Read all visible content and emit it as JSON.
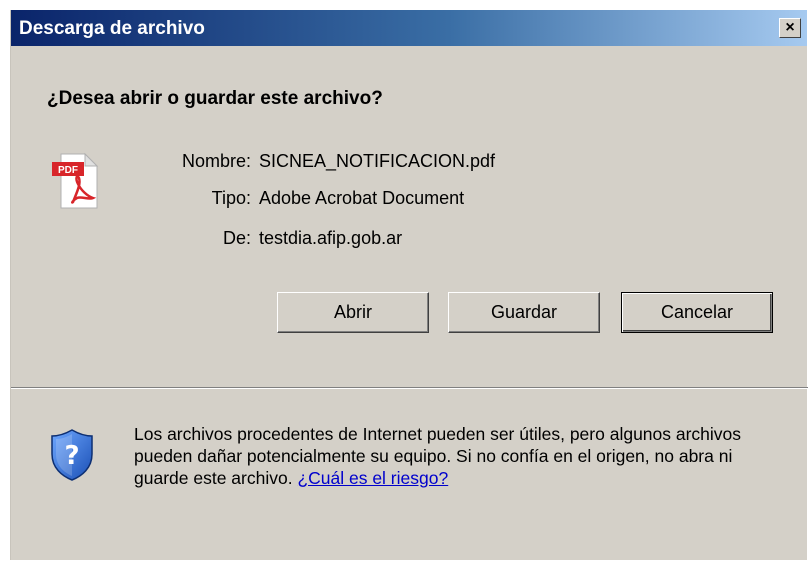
{
  "window": {
    "title": "Descarga de archivo",
    "close_glyph": "×"
  },
  "question": "¿Desea abrir o guardar este archivo?",
  "file": {
    "icon": "pdf-file-icon",
    "icon_badge": "PDF",
    "name_label": "Nombre:",
    "name_value": "SICNEA_NOTIFICACION.pdf",
    "type_label": "Tipo:",
    "type_value": "Adobe Acrobat Document",
    "from_label": "De:",
    "from_value": "testdia.afip.gob.ar"
  },
  "buttons": {
    "open": "Abrir",
    "save": "Guardar",
    "cancel": "Cancelar"
  },
  "warning": {
    "icon": "shield-question-icon",
    "text": "Los archivos procedentes de Internet pueden ser útiles, pero algunos archivos pueden dañar potencialmente su equipo. Si no confía en el origen, no abra ni guarde este archivo. ",
    "link": "¿Cuál es el riesgo?"
  },
  "colors": {
    "titlebar_start": "#0a246a",
    "titlebar_end": "#a6caf0",
    "dialog_bg": "#d4d0c8",
    "link": "#0000cc",
    "pdf_red": "#d8252a"
  }
}
